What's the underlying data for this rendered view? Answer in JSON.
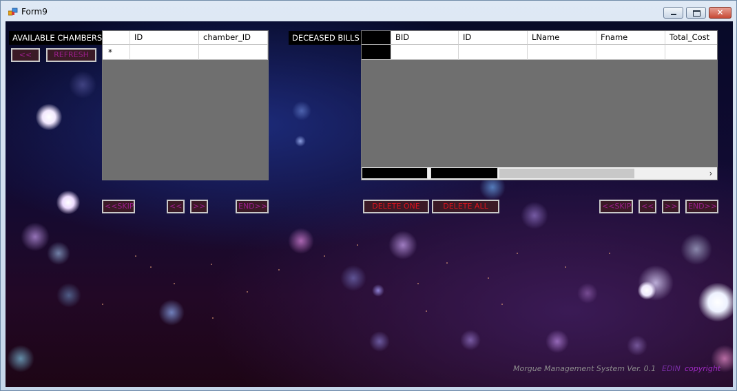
{
  "window": {
    "title": "Form9",
    "minimize_icon": "minimize-icon",
    "maximize_icon": "maximize-icon",
    "close_icon": "close-icon",
    "close_glyph": "✕"
  },
  "chambers": {
    "label": "AVAILABLE CHAMBERS",
    "back_button": "<<",
    "refresh_button": "REFRESH",
    "columns": [
      "ID",
      "chamber_ID"
    ],
    "new_row_marker": "*",
    "nav": {
      "skip_back": "<<SKIP",
      "prev": "<<",
      "next": ">>",
      "end": "END>>"
    }
  },
  "bills": {
    "label": "DECEASED BILLS",
    "columns": [
      "BID",
      "ID",
      "LName",
      "Fname",
      "Total_Cost"
    ],
    "delete_one": "DELETE ONE",
    "delete_all": "DELETE ALL",
    "scroll_arrow": "›",
    "nav": {
      "skip_back": "<<SKIP",
      "prev": "<<",
      "next": ">>",
      "end": "END>>"
    }
  },
  "footer": {
    "system": "Morgue Management System  Ver. 0.1",
    "author": "EDIN",
    "copyright": "copyright"
  },
  "colors": {
    "button_text": "#9b1e8c",
    "danger_text": "#e0121d",
    "grid_bg": "#6f6f6f"
  }
}
